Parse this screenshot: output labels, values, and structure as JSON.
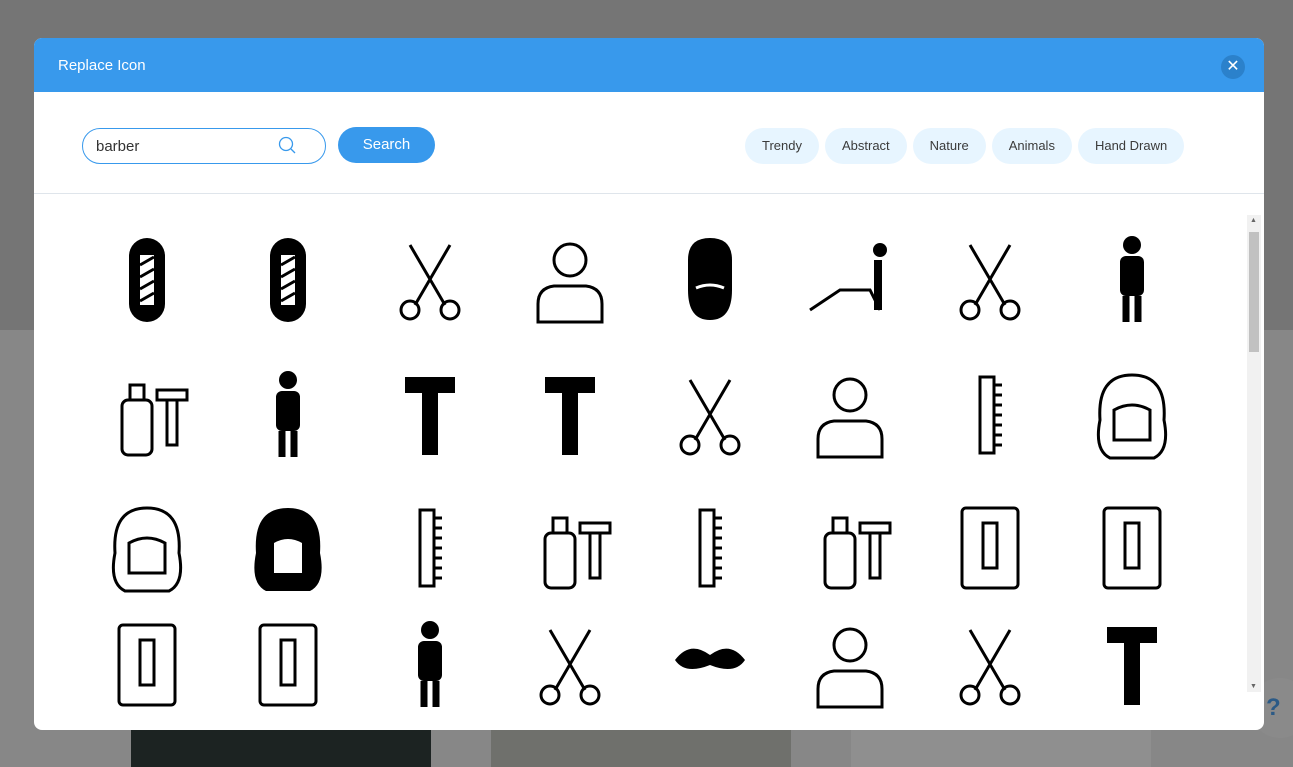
{
  "modal": {
    "title": "Replace Icon",
    "close_icon": "close-icon"
  },
  "search": {
    "value": "barber",
    "button_label": "Search",
    "icon": "search-icon"
  },
  "tags": [
    "Trendy",
    "Abstract",
    "Nature",
    "Animals",
    "Hand Drawn"
  ],
  "colors": {
    "accent": "#3899ec",
    "tag_bg": "#e7f5ff"
  },
  "help": {
    "label": "?"
  },
  "icons": [
    "barber-pole-badge",
    "barber-pole-badge-2",
    "comb-scissors-razor",
    "man-portrait",
    "bearded-man",
    "barber-chair-client",
    "comb-scissors-outline",
    "barber-with-tools",
    "perfume-shaving-brush",
    "barber-person",
    "safety-razor",
    "straight-razor",
    "comb-scissors",
    "man-haircut-cape",
    "comb",
    "woman-hair-outline",
    "woman-hair-outline-2",
    "woman-hair-filled",
    "comb-scissors-thin",
    "foam-razor",
    "comb-scissors-bold",
    "foam-razor-bold",
    "barber-pole-clipboard",
    "barber-pole-tablet",
    "barber-pole-sign",
    "barber-pole-hanging",
    "person-haircut",
    "scissors-comb-filled",
    "mustache",
    "man-portrait-sketch",
    "scissors-comb-diagonal",
    "straight-razor-vertical"
  ]
}
